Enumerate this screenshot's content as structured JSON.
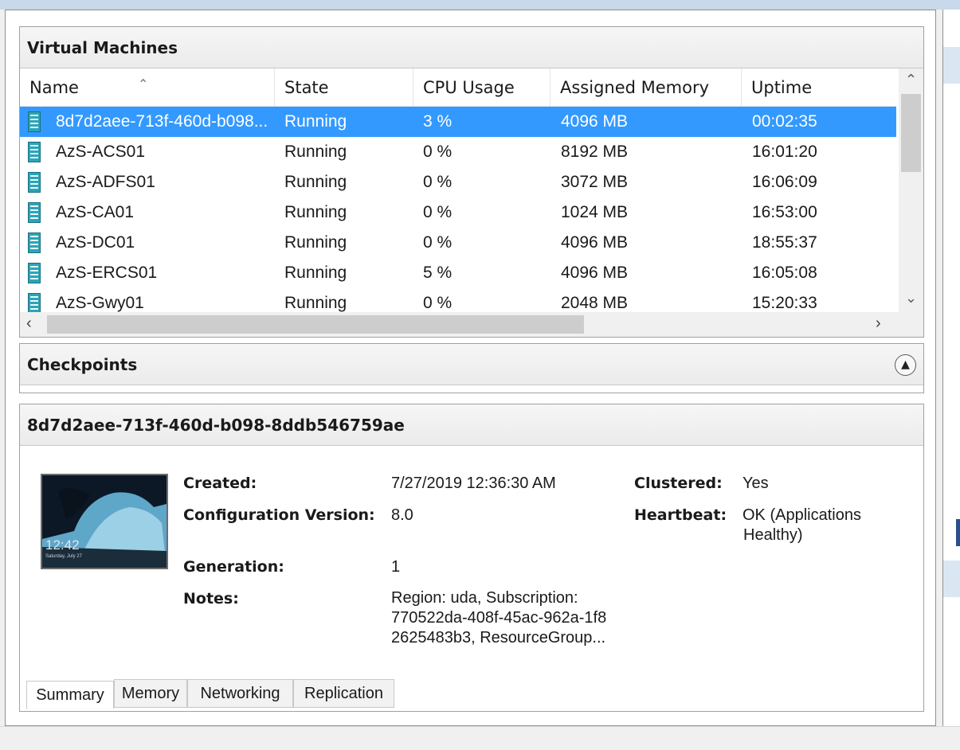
{
  "vm_panel": {
    "title": "Virtual Machines",
    "columns": [
      "Name",
      "State",
      "CPU Usage",
      "Assigned Memory",
      "Uptime"
    ],
    "rows": [
      {
        "name": "8d7d2aee-713f-460d-b098...",
        "state": "Running",
        "cpu": "3 %",
        "memory": "4096 MB",
        "uptime": "00:02:35",
        "selected": true
      },
      {
        "name": "AzS-ACS01",
        "state": "Running",
        "cpu": "0 %",
        "memory": "8192 MB",
        "uptime": "16:01:20"
      },
      {
        "name": "AzS-ADFS01",
        "state": "Running",
        "cpu": "0 %",
        "memory": "3072 MB",
        "uptime": "16:06:09"
      },
      {
        "name": "AzS-CA01",
        "state": "Running",
        "cpu": "0 %",
        "memory": "1024 MB",
        "uptime": "16:53:00"
      },
      {
        "name": "AzS-DC01",
        "state": "Running",
        "cpu": "0 %",
        "memory": "4096 MB",
        "uptime": "18:55:37"
      },
      {
        "name": "AzS-ERCS01",
        "state": "Running",
        "cpu": "5 %",
        "memory": "4096 MB",
        "uptime": "16:05:08"
      },
      {
        "name": "AzS-Gwy01",
        "state": "Running",
        "cpu": "0 %",
        "memory": "2048 MB",
        "uptime": "15:20:33"
      }
    ]
  },
  "checkpoints": {
    "title": "Checkpoints"
  },
  "details": {
    "title": "8d7d2aee-713f-460d-b098-8ddb546759ae",
    "created_label": "Created:",
    "created_value": "7/27/2019 12:36:30 AM",
    "config_label": "Configuration Version:",
    "config_value": "8.0",
    "generation_label": "Generation:",
    "generation_value": "1",
    "notes_label": "Notes:",
    "notes_value": [
      "Region: uda, Subscription:",
      "770522da-408f-45ac-962a-1f8",
      "2625483b3, ResourceGroup..."
    ],
    "clustered_label": "Clustered:",
    "clustered_value": "Yes",
    "heartbeat_label": "Heartbeat:",
    "heartbeat_value": [
      "OK (Applications",
      "Healthy)"
    ],
    "thumbnail_time": "12:42",
    "thumbnail_date": "Saturday, July 27",
    "tabs": [
      "Summary",
      "Memory",
      "Networking",
      "Replication"
    ]
  }
}
